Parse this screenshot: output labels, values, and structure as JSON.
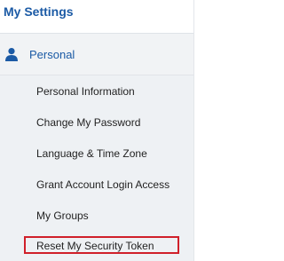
{
  "header": {
    "title": "My Settings"
  },
  "section": {
    "label": "Personal",
    "icon": "person-icon",
    "accent_color": "#1b5aa5"
  },
  "menu": {
    "items": [
      {
        "label": "Personal Information"
      },
      {
        "label": "Change My Password"
      },
      {
        "label": "Language & Time Zone"
      },
      {
        "label": "Grant Account Login Access"
      },
      {
        "label": "My Groups"
      },
      {
        "label": "Reset My Security Token",
        "highlighted": true
      }
    ],
    "highlight_color": "#d0202a"
  }
}
